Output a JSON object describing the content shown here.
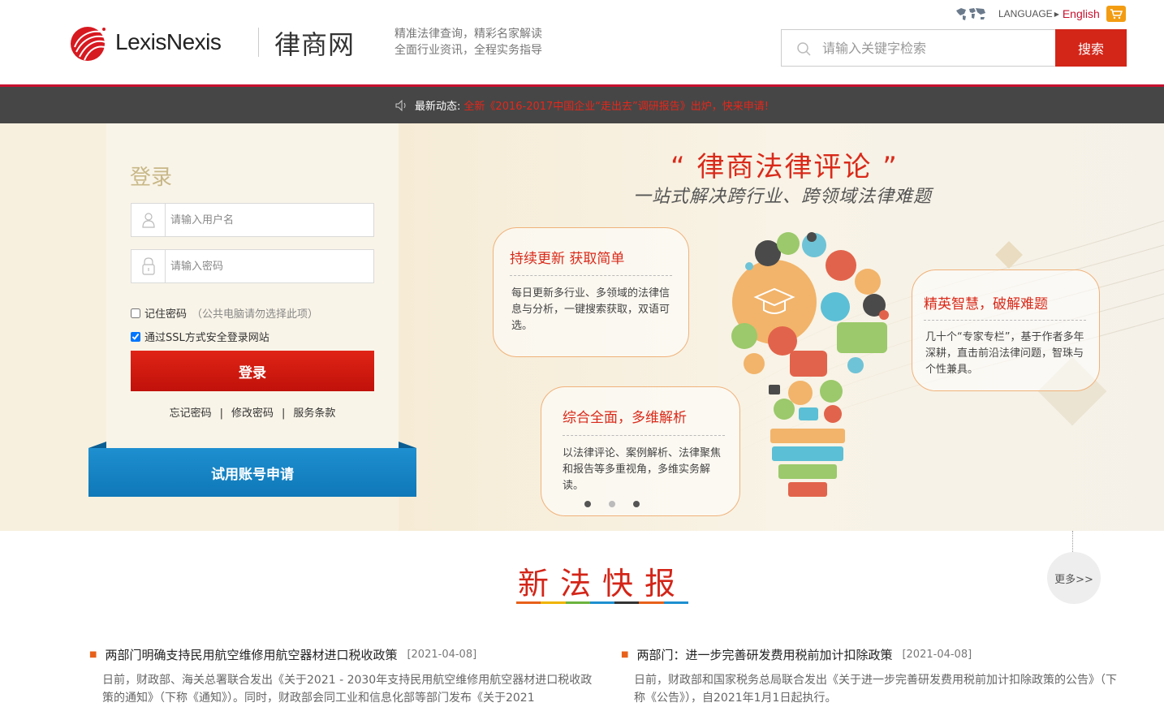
{
  "header": {
    "brand": "LexisNexis",
    "site_name": "律商网",
    "tagline_1": "精准法律查询，精彩名家解读",
    "tagline_2": "全面行业资讯，全程实务指导",
    "language_label": "LANGUAGE",
    "language_option": "English",
    "search_placeholder": "请输入关键字检索",
    "search_button": "搜索"
  },
  "ticker": {
    "label": "最新动态:",
    "text": "全新《2016-2017中国企业“走出去”调研报告》出炉，快来申请!"
  },
  "login": {
    "title": "登录",
    "username_placeholder": "请输入用户名",
    "password_placeholder": "请输入密码",
    "remember_label": "记住密码",
    "remember_hint": "（公共电脑请勿选择此项）",
    "remember_checked": false,
    "ssl_label": "通过SSL方式安全登录网站",
    "ssl_checked": true,
    "submit": "登录",
    "links": [
      "忘记密码",
      "修改密码",
      "服务条款"
    ],
    "trial_button": "试用账号申请"
  },
  "banner": {
    "title": "“ 律商法律评论 ”",
    "subtitle": "一站式解决跨行业、跨领域法律难题",
    "bubbles": [
      {
        "title": "持续更新  获取简单",
        "text": "每日更新多行业、多领域的法律信息与分析，一键搜索获取，双语可选。"
      },
      {
        "title": "综合全面，多维解析",
        "text": "以法律评论、案例解析、法律聚焦和报告等多重视角，多维实务解读。"
      },
      {
        "title": "精英智慧，破解难题",
        "text": "几十个“专家专栏”，基于作者多年深耕，直击前沿法律问题，智珠与个性兼具。"
      }
    ],
    "carousel_active": 0
  },
  "news": {
    "section_title": "新法快报",
    "more": "更多>>",
    "items": [
      {
        "title": "两部门明确支持民用航空维修用航空器材进口税收政策",
        "date": "[2021-04-08]",
        "summary": "日前，财政部、海关总署联合发出《关于2021 - 2030年支持民用航空维修用航空器材进口税收政策的通知》（下称《通知》）。同时，财政部会同工业和信息化部等部门发布《关于2021"
      },
      {
        "title": "两部门：进一步完善研发费用税前加计扣除政策",
        "date": "[2021-04-08]",
        "summary": "日前，财政部和国家税务总局联合发出《关于进一步完善研发费用税前加计扣除政策的公告》（下称《公告》），自2021年1月1日起执行。"
      }
    ]
  },
  "colors": {
    "brand_red": "#d32518",
    "trial_blue": "#1e8fd0",
    "ticker_bg": "#464646",
    "underline": [
      "#e8611a",
      "#f0b400",
      "#6cb33f",
      "#1e8fd0",
      "#333333",
      "#e8611a",
      "#1e8fd0"
    ]
  }
}
